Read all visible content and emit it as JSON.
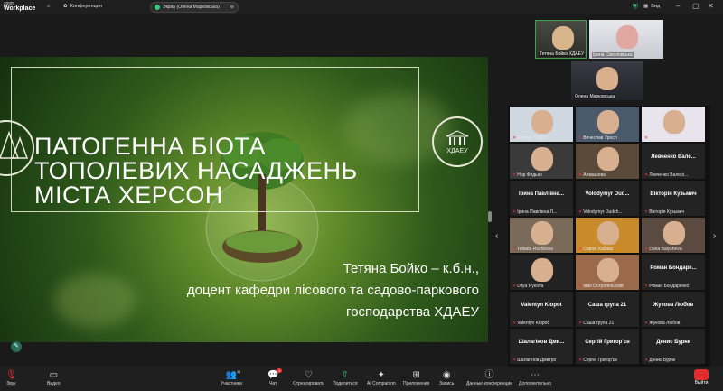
{
  "app": {
    "brand_top": "zoom",
    "brand_bottom": "Workplace"
  },
  "topbar": {
    "home_icon": "home-icon",
    "conference_label": "Конференция",
    "screen_share_label": "Экран (Олена Марковська)",
    "view_label": "Вид",
    "shield_color": "#2ecc71"
  },
  "slide": {
    "title_lines": [
      "ПАТОГЕННА БІОТА",
      "ТОПОЛЕВИХ НАСАДЖЕНЬ",
      "МІСТА ХЕРСОН"
    ],
    "author_lines": [
      "Тетяна Бойко – к.б.н.,",
      "доцент кафедри лісового та садово-паркового",
      "господарства ХДАЕУ"
    ],
    "logo_text": "ХДАЕУ"
  },
  "speakers": [
    {
      "name": "Тетяна Бойко ХДАЕУ"
    },
    {
      "name": "Ірина Соколовська"
    },
    {
      "name": "Олена Марковська"
    }
  ],
  "gallery": [
    {
      "big": "",
      "label": "Тетяна ХОДОС",
      "muted": true
    },
    {
      "big": "",
      "label": "Вячеслав Уросл",
      "muted": true
    },
    {
      "big": "",
      "label": "Ганна Минкіна",
      "muted": true
    },
    {
      "big": "",
      "label": "Нор Федько",
      "muted": true
    },
    {
      "big": "",
      "label": "Алмашова",
      "muted": true
    },
    {
      "big": "Левченко Вале...",
      "label": "Левченко Валері...",
      "muted": true
    },
    {
      "big": "Ірина Павлівна...",
      "label": "Ірина Павлівна Л...",
      "muted": true
    },
    {
      "big": "Volodymyr Dud...",
      "label": "Volodymyr Dudch...",
      "muted": true
    },
    {
      "big": "Вікторія Кузьмич",
      "label": "Вікторія Кузьмич",
      "muted": true
    },
    {
      "big": "",
      "label": "Tetiana Rozhkova",
      "muted": true
    },
    {
      "big": "",
      "label": "Сергій Хаблак",
      "muted": true
    },
    {
      "big": "",
      "label": "Daria Balysheva",
      "muted": true
    },
    {
      "big": "",
      "label": "Dilya Rykova",
      "muted": true
    },
    {
      "big": "",
      "label": "Іван Остропільский",
      "muted": true
    },
    {
      "big": "Роман Бондаре...",
      "label": "Роман Бондаренко",
      "muted": true
    },
    {
      "big": "Valentyn Klopot",
      "label": "Valentyn Klopot",
      "muted": true
    },
    {
      "big": "Саша група 21",
      "label": "Саша група 21",
      "muted": true
    },
    {
      "big": "Жукова Любов",
      "label": "Жукова Любов",
      "muted": true
    },
    {
      "big": "Шалагінов Дми...",
      "label": "Шалагінов Дмитро",
      "muted": true
    },
    {
      "big": "Сергій Григор'єв",
      "label": "Сергій Григор'єв",
      "muted": true
    },
    {
      "big": "Денис Буряк",
      "label": "Денис Буряк",
      "muted": true
    }
  ],
  "toolbar": {
    "audio": "Звук",
    "video": "Видео",
    "participants": "Участники",
    "participants_count": "41",
    "chat": "Чат",
    "chat_badge": "1",
    "react": "Отреагировать",
    "share": "Поделиться",
    "ai": "AI Companion",
    "apps": "Приложения",
    "record": "Запись",
    "info": "Данные конференции",
    "more": "Дополнительно",
    "exit": "Выйти"
  }
}
